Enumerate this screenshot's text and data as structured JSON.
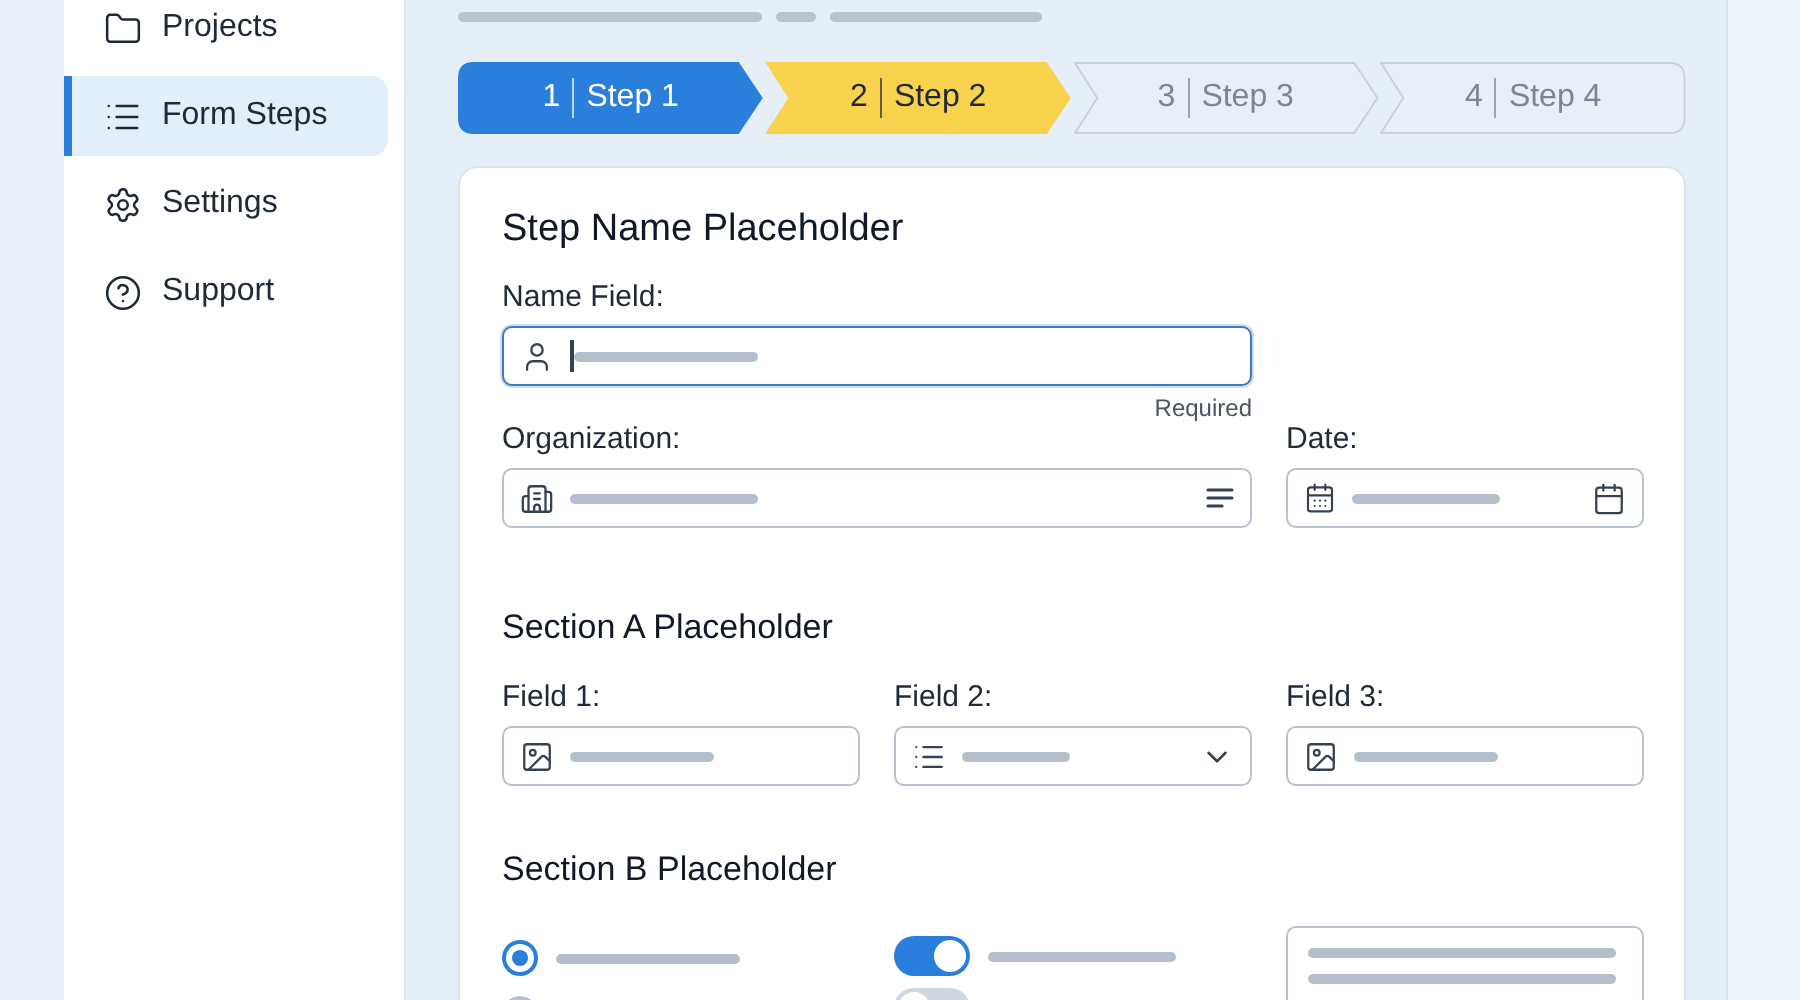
{
  "sidebar": {
    "items": [
      {
        "label": "Projects",
        "selected": false
      },
      {
        "label": "Form Steps",
        "selected": true
      },
      {
        "label": "Settings",
        "selected": false
      },
      {
        "label": "Support",
        "selected": false
      }
    ]
  },
  "stepper": {
    "steps": [
      {
        "number": "1",
        "label": "Step 1",
        "kind": "complete"
      },
      {
        "number": "2",
        "label": "Step 2",
        "kind": "current"
      },
      {
        "number": "3",
        "label": "Step 3",
        "kind": "pending"
      },
      {
        "number": "4",
        "label": "Step 4",
        "kind": "pending"
      }
    ]
  },
  "form": {
    "title": "Step Name Placeholder",
    "name_field": {
      "label": "Name Field:",
      "focused": true,
      "helper": "Required"
    },
    "organization": {
      "label": "Organization:"
    },
    "date": {
      "label": "Date:"
    },
    "section_a": {
      "title": "Section A Placeholder",
      "fields": [
        {
          "label": "Field 1:",
          "kind": "image"
        },
        {
          "label": "Field 2:",
          "kind": "select"
        },
        {
          "label": "Field 3:",
          "kind": "image"
        }
      ]
    },
    "section_b": {
      "title": "Section B Placeholder",
      "columns": [
        {
          "kind": "radios",
          "items": [
            {
              "checked": true
            },
            {
              "checked": false
            }
          ]
        },
        {
          "kind": "toggles",
          "items": [
            {
              "on": true
            },
            {
              "on": false
            }
          ]
        },
        {
          "kind": "text_area"
        }
      ]
    }
  }
}
